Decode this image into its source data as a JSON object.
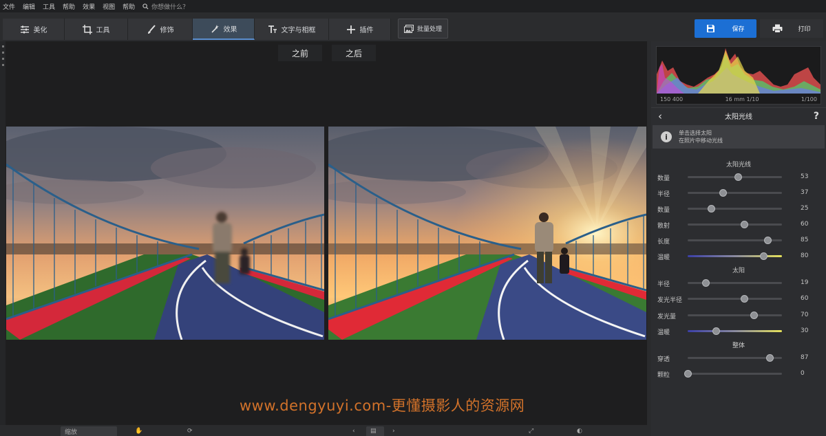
{
  "menubar": {
    "items": [
      "文件",
      "编辑",
      "工具",
      "帮助",
      "效果",
      "视图",
      "帮助"
    ],
    "search_placeholder": "你想做什么？"
  },
  "toolbar": {
    "tabs": [
      {
        "label": "美化",
        "icon": "sliders-icon"
      },
      {
        "label": "工具",
        "icon": "crop-icon"
      },
      {
        "label": "修饰",
        "icon": "brush-icon"
      },
      {
        "label": "效果",
        "icon": "magic-wand-icon"
      },
      {
        "label": "文字与相框",
        "icon": "text-icon"
      },
      {
        "label": "插件",
        "icon": "plus-icon"
      }
    ],
    "active_tab": "效果",
    "batch_label": "批量处理",
    "save_label": "保存",
    "print_label": "打印"
  },
  "compare": {
    "before_label": "之前",
    "after_label": "之后"
  },
  "watermark": "www.dengyuyi.com-更懂摄影人的资源网",
  "histogram": {
    "stats": [
      "150 400",
      "16 mm 1/10",
      "1/100"
    ]
  },
  "panel": {
    "title": "太阳光线",
    "info_line1": "单击选择太阳",
    "info_line2": "在照片中移动光线",
    "sections": [
      {
        "title": "太阳光线",
        "sliders": [
          {
            "label": "数量",
            "value": 53,
            "track": "plain"
          },
          {
            "label": "半径",
            "value": 37,
            "track": "plain"
          },
          {
            "label": "数量",
            "value": 25,
            "track": "plain"
          },
          {
            "label": "散射",
            "value": 60,
            "track": "plain"
          },
          {
            "label": "长度",
            "value": 85,
            "track": "plain"
          },
          {
            "label": "温暖",
            "value": 80,
            "track": "gradient"
          }
        ]
      },
      {
        "title": "太阳",
        "sliders": [
          {
            "label": "半径",
            "value": 19,
            "track": "plain"
          },
          {
            "label": "发光半径",
            "value": 60,
            "track": "plain"
          },
          {
            "label": "发光量",
            "value": 70,
            "track": "plain"
          },
          {
            "label": "温暖",
            "value": 30,
            "track": "gradient"
          }
        ]
      },
      {
        "title": "整体",
        "sliders": [
          {
            "label": "穿透",
            "value": 87,
            "track": "plain"
          },
          {
            "label": "颗粒",
            "value": 0,
            "track": "plain"
          }
        ]
      }
    ]
  },
  "bottombar": {
    "zoom_label": "缩放"
  },
  "colors": {
    "accent": "#1c6fd4",
    "watermark": "#d2722a"
  }
}
